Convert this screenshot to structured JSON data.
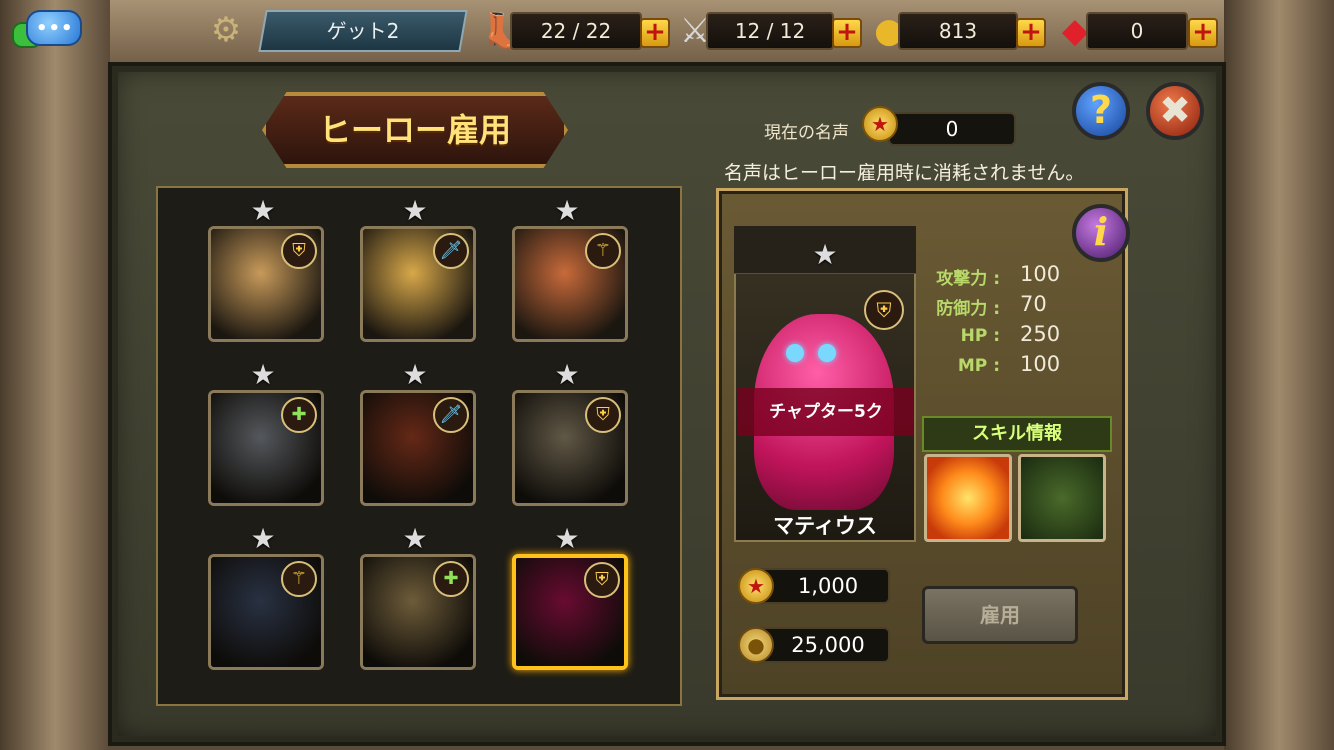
{
  "topbar": {
    "stage": "ゲット2",
    "stamina": "22 / 22",
    "battle": "12 / 12",
    "gold": "813",
    "gems": "0"
  },
  "panel": {
    "title": "ヒーロー雇用",
    "fame_label": "現在の名声",
    "fame_value": "0",
    "fame_note": "名声はヒーロー雇用時に消耗されません。"
  },
  "grid": {
    "slots": [
      {
        "class_icon": "shield-icon",
        "stars": 1,
        "color": "#c89a5a",
        "selected": false,
        "dim": false
      },
      {
        "class_icon": "sword-icon",
        "stars": 1,
        "color": "#d8a84a",
        "selected": false,
        "dim": false
      },
      {
        "class_icon": "staff-icon",
        "stars": 1,
        "color": "#c86a3a",
        "selected": false,
        "dim": false
      },
      {
        "class_icon": "healer-icon",
        "stars": 1,
        "color": "#9aa0a8",
        "selected": false,
        "dim": true
      },
      {
        "class_icon": "sword-icon",
        "stars": 1,
        "color": "#b84a2a",
        "selected": false,
        "dim": true
      },
      {
        "class_icon": "shield-icon",
        "stars": 1,
        "color": "#b0a080",
        "selected": false,
        "dim": true
      },
      {
        "class_icon": "staff-icon",
        "stars": 1,
        "color": "#4a5a7a",
        "selected": false,
        "dim": true
      },
      {
        "class_icon": "healer-icon",
        "stars": 1,
        "color": "#c8a86a",
        "selected": false,
        "dim": true
      },
      {
        "class_icon": "shield-icon",
        "stars": 1,
        "color": "#c0145a",
        "selected": true,
        "dim": true
      }
    ]
  },
  "hero": {
    "name": "マティウス",
    "chapter": "チャプター5ク",
    "stats": [
      {
        "label": "攻撃力",
        "value": "100"
      },
      {
        "label": "防御力",
        "value": "70"
      },
      {
        "label": "HP",
        "value": "250"
      },
      {
        "label": "MP",
        "value": "100"
      }
    ],
    "skill_header": "スキル情報",
    "cost_fame": "1,000",
    "cost_gold": "25,000",
    "hire_label": "雇用"
  },
  "colors": {
    "accent_gold": "#ffc21a",
    "title_text": "#ffe27a",
    "stat_label": "#b8d86a"
  }
}
